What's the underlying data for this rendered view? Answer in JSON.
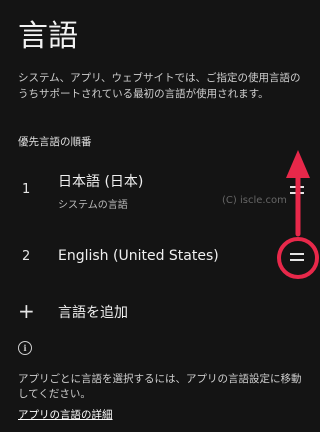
{
  "header": {
    "title": "言語"
  },
  "description": "システム、アプリ、ウェブサイトでは、ご指定の使用言語のうちサポートされている最初の言語が使用されます。",
  "section": {
    "title": "優先言語の順番"
  },
  "languages": [
    {
      "index": "1",
      "name": "日本語 (日本)",
      "subtitle": "システムの言語"
    },
    {
      "index": "2",
      "name": "English (United States)"
    }
  ],
  "watermark": "(C) iscle.com",
  "add_language": {
    "label": "言語を追加"
  },
  "footer": {
    "text": "アプリごとに言語を選択するには、アプリの言語設定に移動してください。",
    "link": "アプリの言語の詳細"
  },
  "icons": {
    "add": "plus-icon",
    "info": "info-icon",
    "drag": "drag-handle-icon"
  },
  "annotation": {
    "color": "#e8284a"
  }
}
